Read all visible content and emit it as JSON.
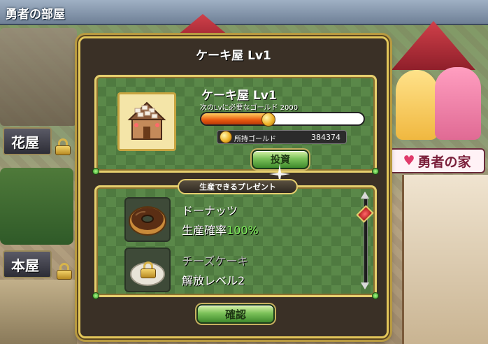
{
  "top_bar": {
    "title": "勇者の部屋"
  },
  "background": {
    "signs": [
      {
        "label": "花屋"
      },
      {
        "label": "本屋"
      }
    ],
    "hero_house": {
      "label": "勇者の家",
      "icon": "heart-icon"
    }
  },
  "dialog": {
    "title": "ケーキ屋 Lv1",
    "shop": {
      "name": "ケーキ屋 Lv1",
      "next_level_requirement": "次のLvに必要なゴールド 2000",
      "progress_fraction": 0.41,
      "gold_label": "所持ゴールド",
      "gold_value": "384374",
      "invest_button": "投資"
    },
    "present_section": {
      "header": "生産できるプレゼント",
      "items": [
        {
          "name": "ドーナッツ",
          "sub_prefix": "生産確率",
          "sub_value": "100%",
          "locked": false,
          "icon": "donut-icon"
        },
        {
          "name": "チーズケーキ",
          "sub_prefix": "解放レベル2",
          "sub_value": "",
          "locked": true,
          "icon": "lock-icon"
        }
      ]
    },
    "confirm_button": "確認"
  },
  "colors": {
    "accent_gold": "#e2c65a",
    "panel_green": "#4f7a40",
    "percent_green": "#7ff25a"
  }
}
